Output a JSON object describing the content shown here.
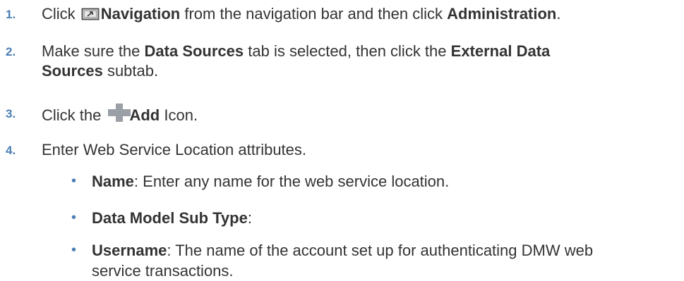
{
  "steps": [
    {
      "number": "1.",
      "pre": "Click ",
      "icon": "navigation-icon",
      "bold1": "Navigation",
      "mid": " from the navigation bar and then click ",
      "bold2": "Administration",
      "post": "."
    },
    {
      "number": "2.",
      "pre": "Make sure the ",
      "bold1": "Data Sources",
      "mid": " tab is selected, then click the ",
      "bold2": "External Data",
      "bold2b": "Sources",
      "post": " subtab."
    },
    {
      "number": "3.",
      "pre": "Click the ",
      "icon": "add-icon",
      "bold1": "Add",
      "post": " Icon."
    },
    {
      "number": "4.",
      "text": "Enter Web Service Location attributes."
    }
  ],
  "bullets": [
    {
      "term": "Name",
      "desc": ": Enter any name for the web service location."
    },
    {
      "term": "Data Model Sub Type",
      "desc": ":"
    },
    {
      "term": "Username",
      "desc": ": The name of the account set up for authenticating DMW web",
      "desc2": "service transactions."
    }
  ],
  "colors": {
    "number": "#4a7fb5",
    "text": "#333333",
    "add_icon": "#9aa0a6",
    "nav_icon": "#555555"
  }
}
